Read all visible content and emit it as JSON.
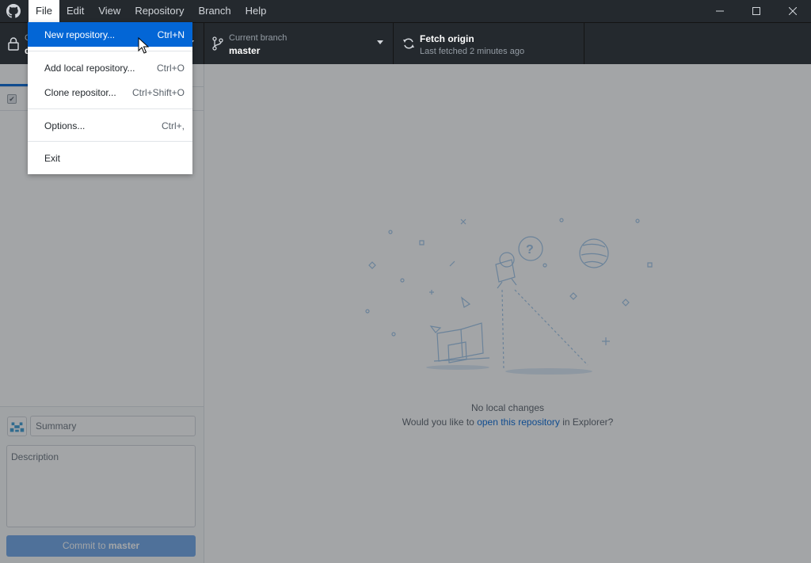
{
  "menubar": {
    "items": [
      "File",
      "Edit",
      "View",
      "Repository",
      "Branch",
      "Help"
    ],
    "active": "File"
  },
  "window": {
    "minimize": "—",
    "maximize": "☐",
    "close": "✕"
  },
  "toolbar": {
    "repo_label": "C",
    "repo_value": "d",
    "branch_label": "Current branch",
    "branch_value": "master",
    "fetch_title": "Fetch origin",
    "fetch_sub": "Last fetched 2 minutes ago"
  },
  "file_menu": {
    "items": [
      {
        "label": "New repository...",
        "accel": "Ctrl+N",
        "highlighted": true
      },
      {
        "label": "Add local repository...",
        "accel": "Ctrl+O"
      },
      {
        "label": "Clone repositor...",
        "accel": "Ctrl+Shift+O"
      },
      {
        "label": "Options...",
        "accel": "Ctrl+,"
      },
      {
        "label": "Exit",
        "accel": ""
      }
    ]
  },
  "commit": {
    "summary_placeholder": "Summary",
    "description_placeholder": "Description",
    "button_prefix": "Commit to ",
    "button_branch": "master"
  },
  "blank_slate": {
    "title": "No local changes",
    "sub_prefix": "Would you like to ",
    "sub_link": "open this repository",
    "sub_suffix": " in Explorer?"
  },
  "colors": {
    "accent": "#0366d6",
    "titlebar": "#24292e",
    "commit_button": "#6ea5e8"
  }
}
